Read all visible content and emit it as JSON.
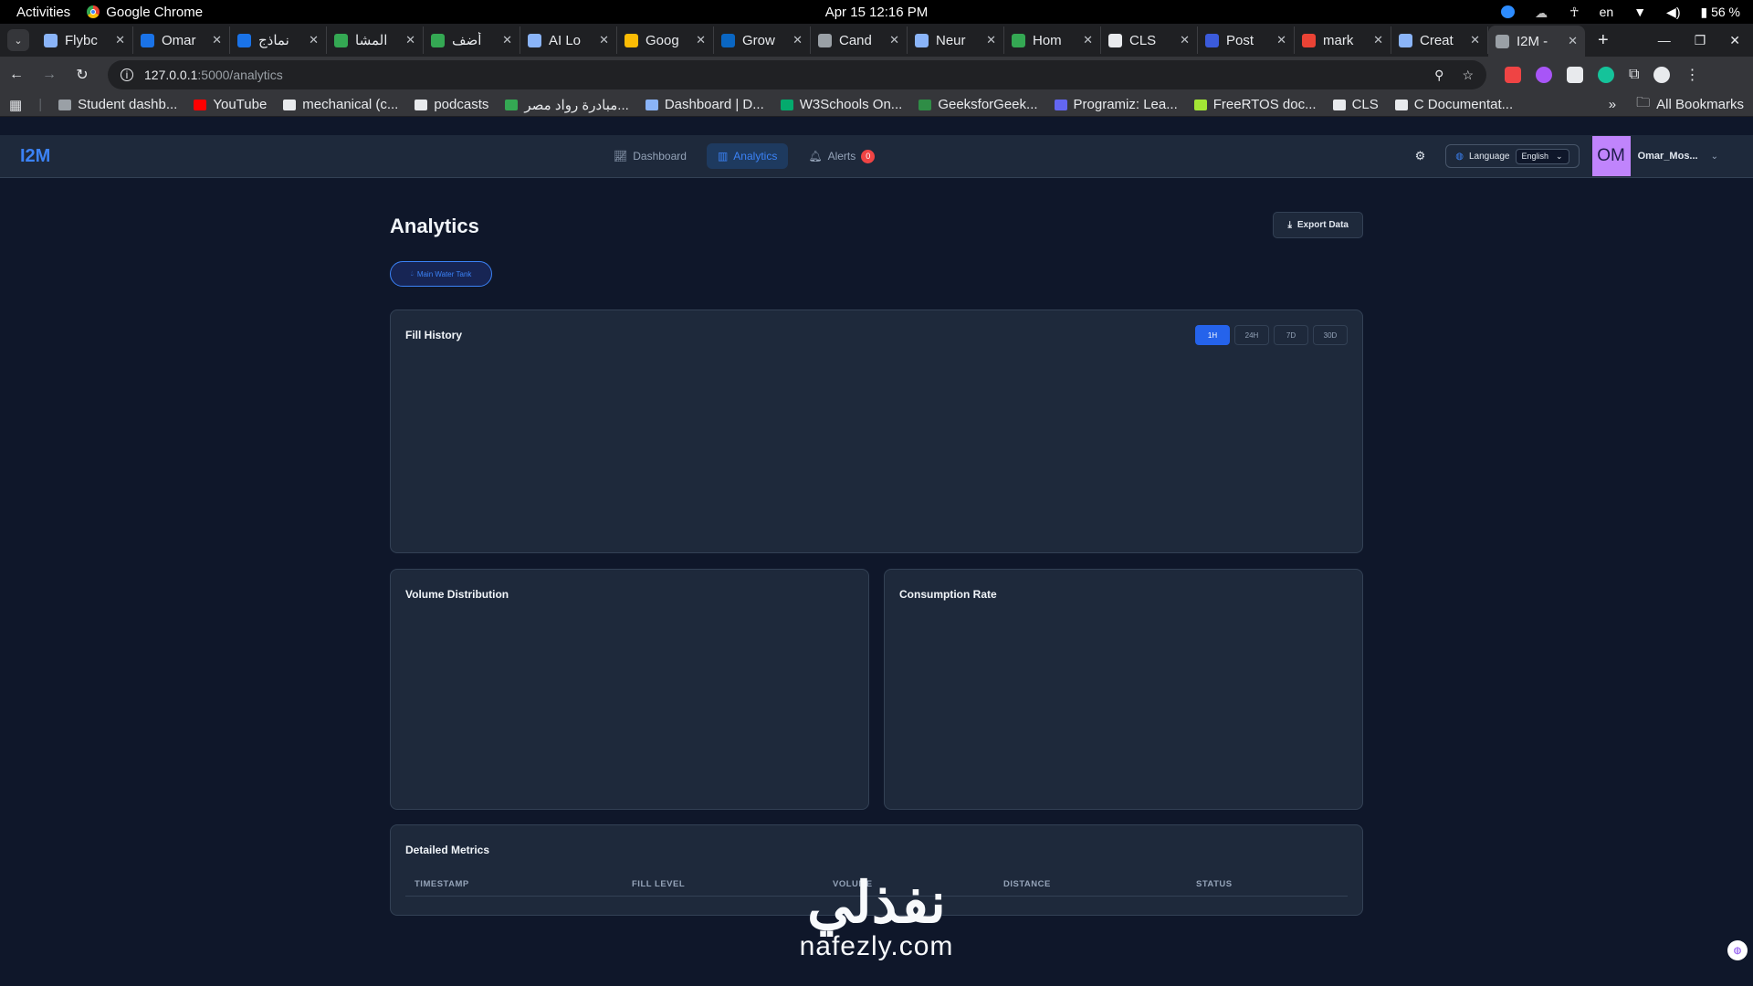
{
  "system": {
    "activities": "Activities",
    "app_name": "Google Chrome",
    "clock": "Apr 15  12:16 PM",
    "lang": "en",
    "battery": "56 %"
  },
  "browser": {
    "tabs": [
      {
        "title": "Flybc",
        "color": "#8ab4f8"
      },
      {
        "title": "Omar",
        "color": "#1a73e8"
      },
      {
        "title": "نماذج",
        "color": "#1a73e8"
      },
      {
        "title": "المشا",
        "color": "#34a853"
      },
      {
        "title": "أضف",
        "color": "#34a853"
      },
      {
        "title": "AI Lo",
        "color": "#8ab4f8"
      },
      {
        "title": "Goog",
        "color": "#fbbc05"
      },
      {
        "title": "Grow",
        "color": "#0a66c2"
      },
      {
        "title": "Cand",
        "color": "#9aa0a6"
      },
      {
        "title": "Neur",
        "color": "#8ab4f8"
      },
      {
        "title": "Hom",
        "color": "#34a853"
      },
      {
        "title": "CLS",
        "color": "#e8eaed"
      },
      {
        "title": "Post",
        "color": "#3b5bdb"
      },
      {
        "title": "mark",
        "color": "#ea4335"
      },
      {
        "title": "Creat",
        "color": "#8ab4f8"
      },
      {
        "title": "I2M -",
        "color": "#9aa0a6"
      }
    ],
    "new_tab": "+",
    "url_host": "127.0.0.1",
    "url_path": ":5000/analytics",
    "bookmarks": [
      {
        "label": "Student dashb...",
        "color": "#9aa0a6"
      },
      {
        "label": "YouTube",
        "color": "#ff0000"
      },
      {
        "label": "mechanical (c...",
        "color": "#e8eaed"
      },
      {
        "label": "podcasts",
        "color": "#e8eaed"
      },
      {
        "label": "مبادرة رواد مصر...",
        "color": "#34a853"
      },
      {
        "label": "Dashboard | D...",
        "color": "#8ab4f8"
      },
      {
        "label": "W3Schools On...",
        "color": "#04aa6d"
      },
      {
        "label": "GeeksforGeek...",
        "color": "#2f8d46"
      },
      {
        "label": "Programiz: Lea...",
        "color": "#6366f1"
      },
      {
        "label": "FreeRTOS doc...",
        "color": "#a3e635"
      },
      {
        "label": "CLS",
        "color": "#e8eaed"
      },
      {
        "label": "C Documentat...",
        "color": "#e8eaed"
      }
    ],
    "more": "»",
    "all_bookmarks": "All Bookmarks"
  },
  "app": {
    "brand": "I2M",
    "nav": {
      "dashboard": "Dashboard",
      "analytics": "Analytics",
      "alerts": "Alerts",
      "alerts_count": "0"
    },
    "language_label": "Language",
    "language_value": "English",
    "avatar_initials": "OM",
    "username": "Omar_Mos...",
    "page_title": "Analytics",
    "export_label": "Export Data",
    "tank_label": "Main Water Tank",
    "fill_history": {
      "title": "Fill History",
      "ranges": [
        "1H",
        "24H",
        "7D",
        "30D"
      ],
      "active_range": "1H"
    },
    "volume_title": "Volume Distribution",
    "consumption_title": "Consumption Rate",
    "metrics": {
      "title": "Detailed Metrics",
      "columns": [
        "TIMESTAMP",
        "FILL LEVEL",
        "VOLUME",
        "DISTANCE",
        "STATUS"
      ]
    }
  },
  "watermark": {
    "arabic": "نفذلي",
    "url": "nafezly.com"
  },
  "colors": {
    "accent": "#3b82f6",
    "background": "#0f172a",
    "card": "#1e293b",
    "alert": "#ef4444"
  }
}
